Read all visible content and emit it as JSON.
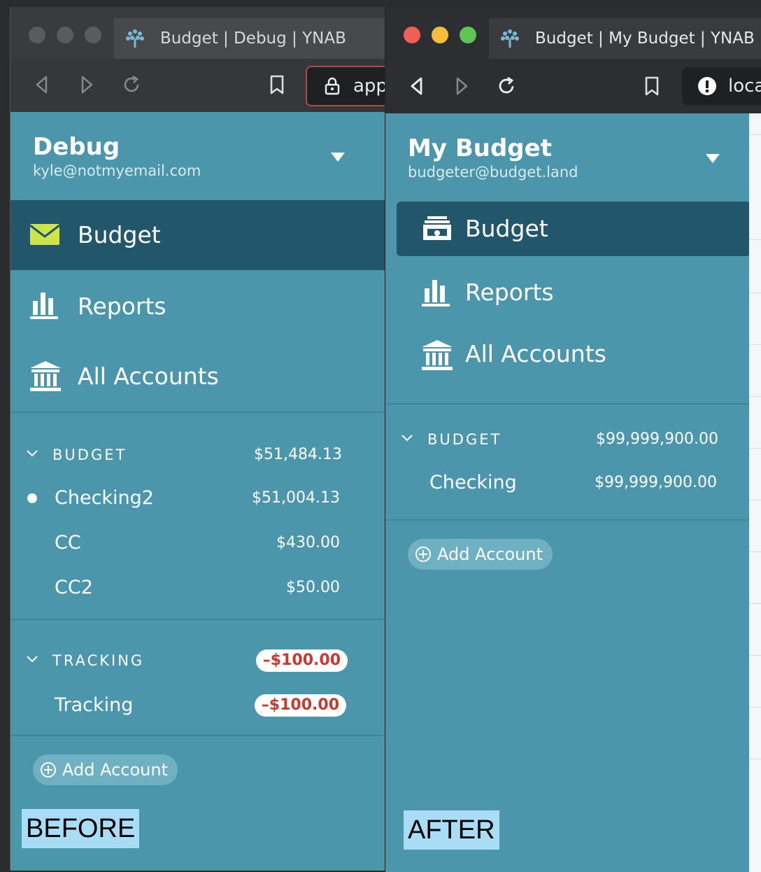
{
  "before": {
    "tab_title": "Budget | Debug | YNAB",
    "url": "app",
    "budget_name": "Debug",
    "email": "kyle@notmyemail.com",
    "nav": [
      {
        "label": "Budget",
        "icon": "envelope-icon",
        "active": true
      },
      {
        "label": "Reports",
        "icon": "bar-chart-icon",
        "active": false
      },
      {
        "label": "All Accounts",
        "icon": "bank-icon",
        "active": false
      }
    ],
    "budget_section": {
      "label": "BUDGET",
      "amount": "$51,484.13"
    },
    "accounts": [
      {
        "name": "Checking2",
        "amount": "$51,004.13",
        "selected": true
      },
      {
        "name": "CC",
        "amount": "$430.00",
        "selected": false
      },
      {
        "name": "CC2",
        "amount": "$50.00",
        "selected": false
      }
    ],
    "tracking_section": {
      "label": "TRACKING",
      "amount": "–$100.00"
    },
    "tracking_accounts": [
      {
        "name": "Tracking",
        "amount": "–$100.00"
      }
    ],
    "add_account_label": "Add Account",
    "caption": "BEFORE"
  },
  "after": {
    "tab_title": "Budget | My Budget | YNAB",
    "url": "loca",
    "budget_name": "My Budget",
    "email": "budgeter@budget.land",
    "nav": [
      {
        "label": "Budget",
        "icon": "piggybank-icon",
        "active": true
      },
      {
        "label": "Reports",
        "icon": "bar-chart-icon",
        "active": false
      },
      {
        "label": "All Accounts",
        "icon": "bank-icon",
        "active": false
      }
    ],
    "budget_section": {
      "label": "BUDGET",
      "amount": "$99,999,900.00"
    },
    "accounts": [
      {
        "name": "Checking",
        "amount": "$99,999,900.00"
      }
    ],
    "add_account_label": "Add Account",
    "caption": "AFTER"
  },
  "colors": {
    "sidebar": "#4b96ab",
    "active_nav": "#22566b",
    "envelope": "#cde44a",
    "negative": "#c9392f",
    "caption_bg": "#a8ddf5"
  }
}
